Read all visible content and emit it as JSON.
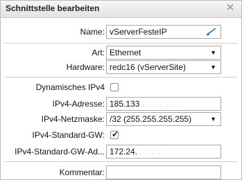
{
  "dialog": {
    "title": "Schnittstelle bearbeiten",
    "close_symbol": "✕"
  },
  "form": {
    "name_label": "Name:",
    "name_value": "vServerFesteIP",
    "edit_icon": "pen-icon",
    "art_label": "Art:",
    "art_value": "Ethernet",
    "hardware_label": "Hardware:",
    "hardware_value": "redc16 (vServerSite)",
    "dhcp_label": "Dynamisches IPv4",
    "dhcp_checked": false,
    "ipv4_label": "IPv4-Adresse:",
    "ipv4_value": "185.133",
    "ipv4_obscured": ". . . . . .",
    "netmask_label": "IPv4-Netzmaske:",
    "netmask_value": "/32 (255.255.255.255)",
    "std_gw_label": "IPv4-Standard-GW:",
    "std_gw_checked": true,
    "std_gw_addr_label": "IPv4-Standard-GW-Ad...",
    "std_gw_addr_value": "172.24.",
    "std_gw_addr_obscured": ". . . .",
    "comment_label": "Kommentar:",
    "comment_value": ""
  },
  "colors": {
    "accent_pen": "#1f6fb2"
  }
}
